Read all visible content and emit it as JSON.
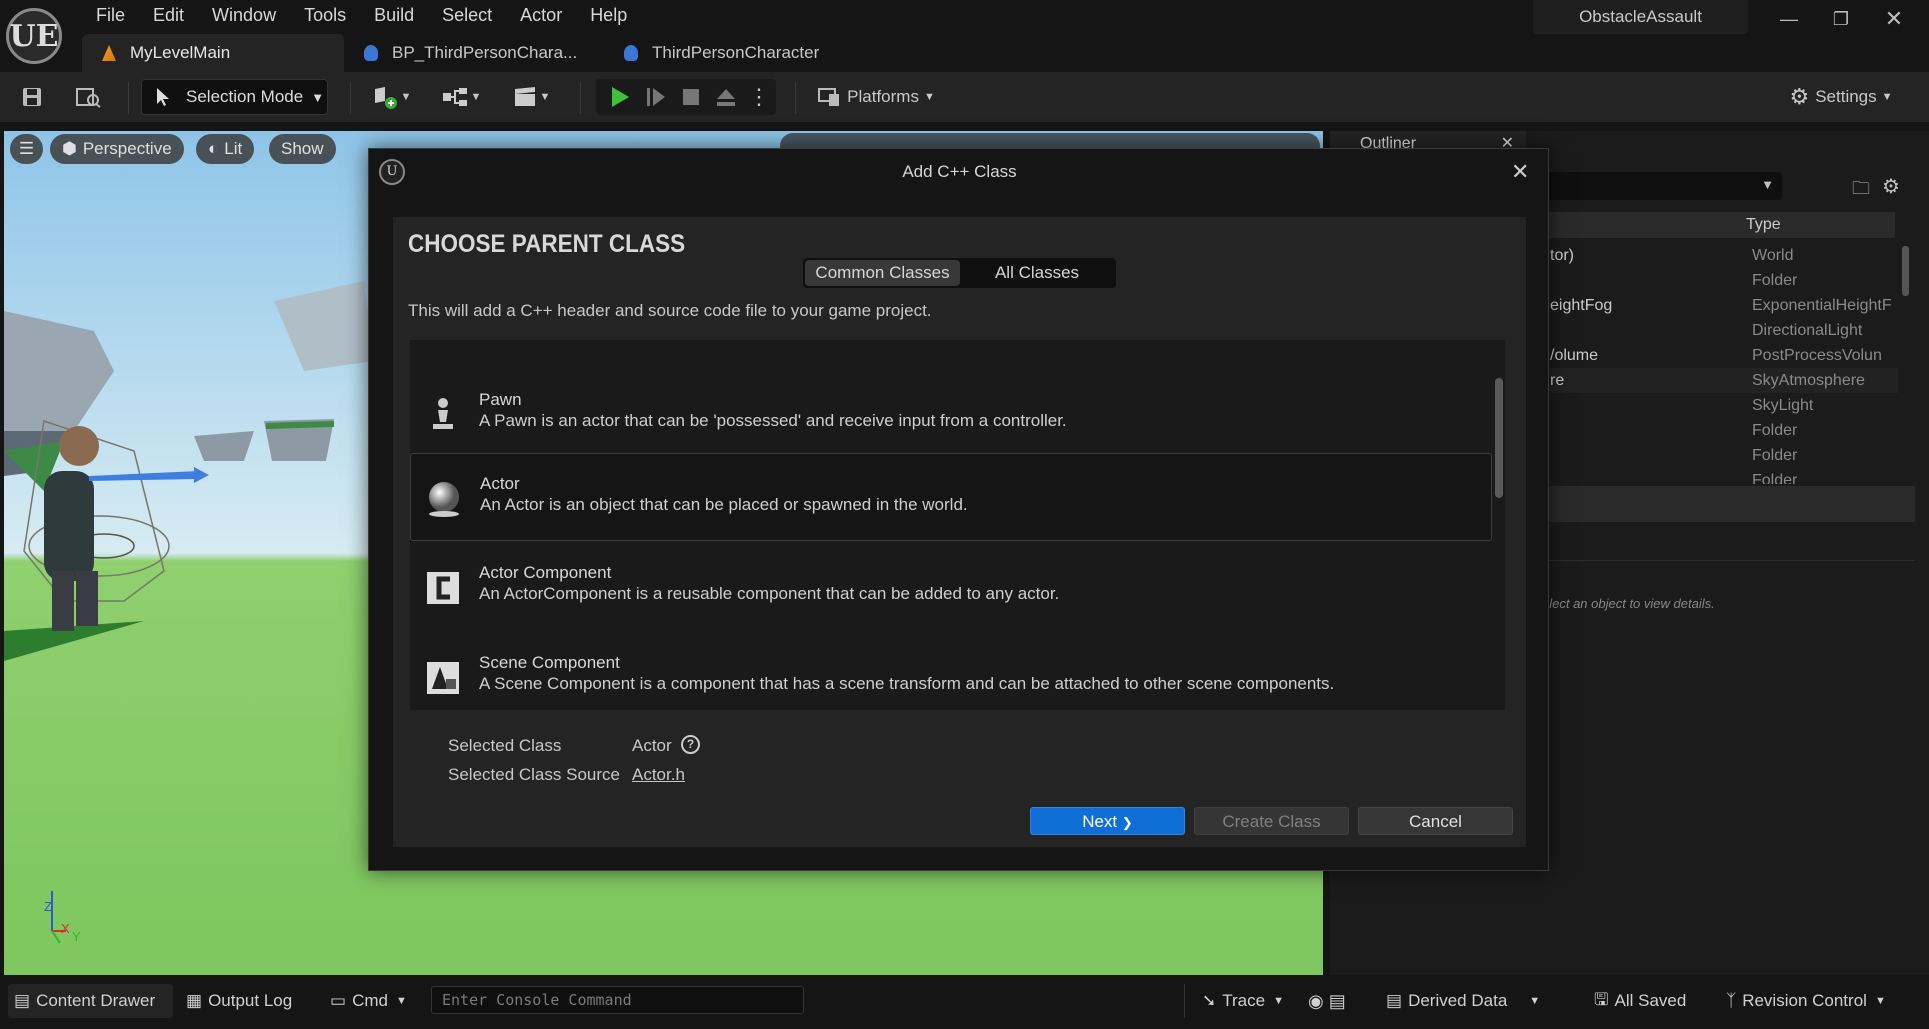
{
  "app": {
    "menu": [
      "File",
      "Edit",
      "Window",
      "Tools",
      "Build",
      "Select",
      "Actor",
      "Help"
    ],
    "project": "ObstacleAssault",
    "logo": "UE"
  },
  "tabs": [
    {
      "label": "MyLevelMain",
      "icon": "level-icon"
    },
    {
      "label": "BP_ThirdPersonChara...",
      "icon": "blueprint-icon"
    },
    {
      "label": "ThirdPersonCharacter",
      "icon": "blueprint-icon"
    }
  ],
  "toolbar": {
    "selection_mode": "Selection Mode",
    "platforms": "Platforms",
    "settings": "Settings"
  },
  "viewport": {
    "perspective": "Perspective",
    "lit": "Lit",
    "show": "Show",
    "axis_z": "Z",
    "axis_x": "X",
    "axis_y": "Y"
  },
  "outliner": {
    "tab": "Outliner",
    "type_header": "Type",
    "rows": [
      {
        "name": "tor)",
        "type": "World"
      },
      {
        "name": "",
        "type": "Folder"
      },
      {
        "name": "eightFog",
        "type": "ExponentialHeightF"
      },
      {
        "name": "",
        "type": "DirectionalLight"
      },
      {
        "name": "/olume",
        "type": "PostProcessVolun"
      },
      {
        "name": "re",
        "type": "SkyAtmosphere"
      },
      {
        "name": "",
        "type": "SkyLight"
      },
      {
        "name": "",
        "type": "Folder"
      },
      {
        "name": "",
        "type": "Folder"
      },
      {
        "name": "",
        "type": "Folder"
      }
    ],
    "details_hint": "elect an object to view details."
  },
  "dialog": {
    "title": "Add C++ Class",
    "heading": "CHOOSE PARENT CLASS",
    "tab_common": "Common Classes",
    "tab_all": "All Classes",
    "description": "This will add a C++ header and source code file to your game project.",
    "classes": [
      {
        "name": "Pawn",
        "desc": "A Pawn is an actor that can be 'possessed' and receive input from a controller.",
        "icon": "pawn-icon"
      },
      {
        "name": "Actor",
        "desc": "An Actor is an object that can be placed or spawned in the world.",
        "icon": "actor-sphere-icon"
      },
      {
        "name": "Actor Component",
        "desc": "An ActorComponent is a reusable component that can be added to any actor.",
        "icon": "actor-component-icon"
      },
      {
        "name": "Scene Component",
        "desc": "A Scene Component is a component that has a scene transform and can be attached to other scene components.",
        "icon": "scene-component-icon"
      }
    ],
    "selected_class_label": "Selected Class",
    "selected_class": "Actor",
    "selected_source_label": "Selected Class Source",
    "selected_source": "Actor.h",
    "next": "Next",
    "create": "Create Class",
    "cancel": "Cancel"
  },
  "bottom": {
    "content_drawer": "Content Drawer",
    "output_log": "Output Log",
    "cmd": "Cmd",
    "console_placeholder": "Enter Console Command",
    "trace": "Trace",
    "derived_data": "Derived Data",
    "all_saved": "All Saved",
    "revision_control": "Revision Control"
  }
}
